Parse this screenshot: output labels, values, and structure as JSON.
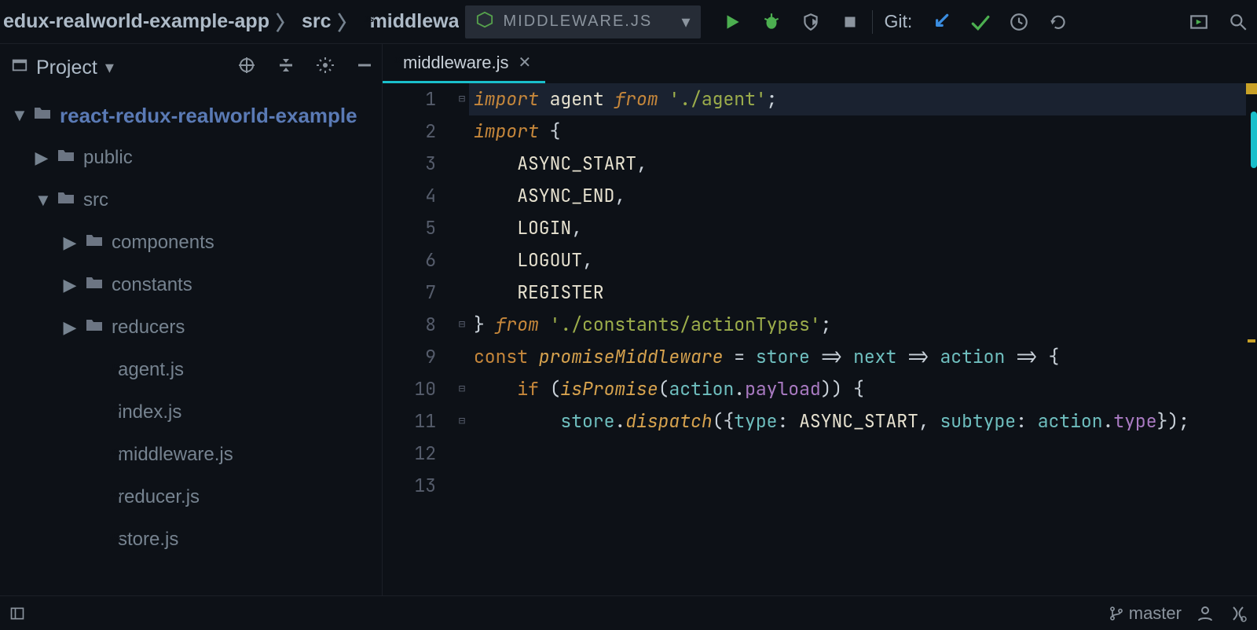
{
  "breadcrumb": {
    "root": "edux-realworld-example-app",
    "mid": "src",
    "file": "middlewa"
  },
  "run_config": {
    "name": "MIDDLEWARE.JS"
  },
  "git_label": "Git:",
  "project": {
    "title": "Project",
    "root": "react-redux-realworld-example",
    "tree": [
      {
        "name": "public",
        "type": "dir",
        "depth": 1,
        "expanded": false
      },
      {
        "name": "src",
        "type": "dir",
        "depth": 1,
        "expanded": true
      },
      {
        "name": "components",
        "type": "dir",
        "depth": 2,
        "expanded": false
      },
      {
        "name": "constants",
        "type": "dir",
        "depth": 2,
        "expanded": false
      },
      {
        "name": "reducers",
        "type": "dir",
        "depth": 2,
        "expanded": false
      },
      {
        "name": "agent.js",
        "type": "js",
        "depth": 3
      },
      {
        "name": "index.js",
        "type": "js",
        "depth": 3
      },
      {
        "name": "middleware.js",
        "type": "js",
        "depth": 3
      },
      {
        "name": "reducer.js",
        "type": "js",
        "depth": 3
      },
      {
        "name": "store.js",
        "type": "js",
        "depth": 3
      }
    ]
  },
  "tab": {
    "label": "middleware.js"
  },
  "code": {
    "line_numbers": [
      "1",
      "2",
      "3",
      "4",
      "5",
      "6",
      "7",
      "8",
      "9",
      "10",
      "11",
      "12",
      "13"
    ],
    "tokens": [
      [
        {
          "t": "import",
          "c": "kw"
        },
        {
          "t": " ",
          "c": "op"
        },
        {
          "t": "agent",
          "c": "ident"
        },
        {
          "t": " ",
          "c": "op"
        },
        {
          "t": "from",
          "c": "kw"
        },
        {
          "t": " ",
          "c": "op"
        },
        {
          "t": "'./agent'",
          "c": "str"
        },
        {
          "t": ";",
          "c": "op"
        }
      ],
      [
        {
          "t": "import",
          "c": "kw"
        },
        {
          "t": " {",
          "c": "op"
        }
      ],
      [
        {
          "t": "    ",
          "c": "op"
        },
        {
          "t": "ASYNC_START",
          "c": "cst"
        },
        {
          "t": ",",
          "c": "op"
        }
      ],
      [
        {
          "t": "    ",
          "c": "op"
        },
        {
          "t": "ASYNC_END",
          "c": "cst"
        },
        {
          "t": ",",
          "c": "op"
        }
      ],
      [
        {
          "t": "    ",
          "c": "op"
        },
        {
          "t": "LOGIN",
          "c": "cst"
        },
        {
          "t": ",",
          "c": "op"
        }
      ],
      [
        {
          "t": "    ",
          "c": "op"
        },
        {
          "t": "LOGOUT",
          "c": "cst"
        },
        {
          "t": ",",
          "c": "op"
        }
      ],
      [
        {
          "t": "    ",
          "c": "op"
        },
        {
          "t": "REGISTER",
          "c": "cst"
        }
      ],
      [
        {
          "t": "} ",
          "c": "op"
        },
        {
          "t": "from",
          "c": "kw"
        },
        {
          "t": " ",
          "c": "op"
        },
        {
          "t": "'./constants/actionTypes'",
          "c": "str"
        },
        {
          "t": ";",
          "c": "op"
        }
      ],
      [
        {
          "t": "",
          "c": "op"
        }
      ],
      [
        {
          "t": "const",
          "c": "kw2"
        },
        {
          "t": " ",
          "c": "op"
        },
        {
          "t": "promiseMiddleware",
          "c": "fn-decl"
        },
        {
          "t": " = ",
          "c": "op"
        },
        {
          "t": "store",
          "c": "local"
        },
        {
          "t": " => ",
          "c": "op"
        },
        {
          "t": "next",
          "c": "local"
        },
        {
          "t": " => ",
          "c": "op"
        },
        {
          "t": "action",
          "c": "local"
        },
        {
          "t": " => {",
          "c": "op"
        }
      ],
      [
        {
          "t": "    ",
          "c": "op"
        },
        {
          "t": "if",
          "c": "kw2"
        },
        {
          "t": " (",
          "c": "op"
        },
        {
          "t": "isPromise",
          "c": "method"
        },
        {
          "t": "(",
          "c": "op"
        },
        {
          "t": "action",
          "c": "local"
        },
        {
          "t": ".",
          "c": "op"
        },
        {
          "t": "payload",
          "c": "param"
        },
        {
          "t": ")) {",
          "c": "op"
        }
      ],
      [
        {
          "t": "        ",
          "c": "op"
        },
        {
          "t": "store",
          "c": "local"
        },
        {
          "t": ".",
          "c": "op"
        },
        {
          "t": "dispatch",
          "c": "method"
        },
        {
          "t": "({",
          "c": "op"
        },
        {
          "t": "type",
          "c": "local"
        },
        {
          "t": ": ",
          "c": "op"
        },
        {
          "t": "ASYNC_START",
          "c": "cst"
        },
        {
          "t": ", ",
          "c": "op"
        },
        {
          "t": "subtype",
          "c": "local"
        },
        {
          "t": ": ",
          "c": "op"
        },
        {
          "t": "action",
          "c": "local"
        },
        {
          "t": ".",
          "c": "op"
        },
        {
          "t": "type",
          "c": "param"
        },
        {
          "t": "});",
          "c": "op"
        }
      ],
      [
        {
          "t": "",
          "c": "op"
        }
      ]
    ]
  },
  "status": {
    "branch": "master"
  }
}
